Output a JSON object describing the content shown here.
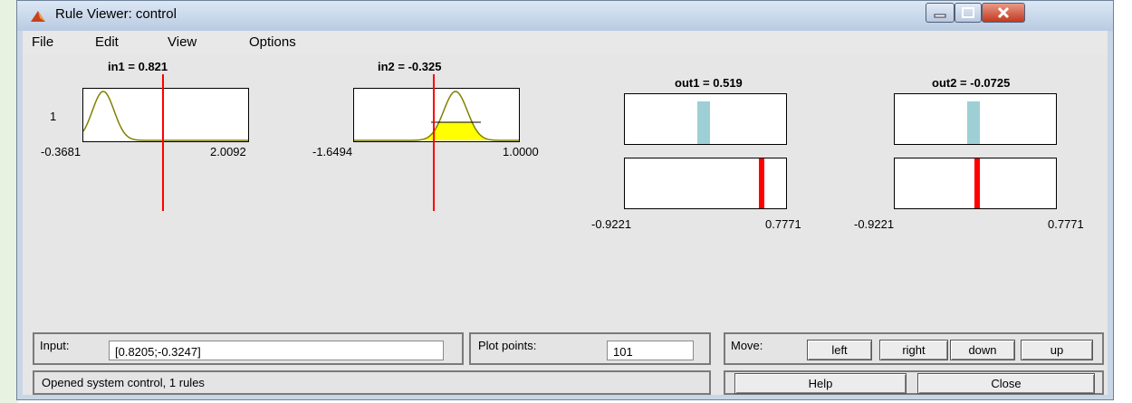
{
  "window": {
    "title": "Rule Viewer: control",
    "icon": "matlab-icon",
    "titlebar_buttons": [
      "minimize-icon",
      "maximize-icon",
      "close-icon"
    ]
  },
  "menu": [
    "File",
    "Edit",
    "View",
    "Options"
  ],
  "inputs": [
    {
      "label": "in1 = 0.821",
      "min": "-0.3681",
      "max": "2.0092",
      "value": 0.821,
      "rule_number": "1"
    },
    {
      "label": "in2 = -0.325",
      "min": "-1.6494",
      "max": "1.0000",
      "value": -0.325
    }
  ],
  "outputs": [
    {
      "label": "out1 = 0.519",
      "min": "-0.9221",
      "max": "0.7771",
      "value": 0.519
    },
    {
      "label": "out2 = -0.0725",
      "min": "-0.9221",
      "max": "0.7771",
      "value": -0.0725
    }
  ],
  "colors": {
    "marker": "#ff0000",
    "mf_line": "#808000",
    "fill": "#ffff00",
    "output_bar": "#9ecfd4"
  },
  "input_panel": {
    "label": "Input:",
    "value": "[0.8205;-0.3247]"
  },
  "plot_points": {
    "label": "Plot points:",
    "value": "101"
  },
  "move": {
    "label": "Move:",
    "buttons": [
      "left",
      "right",
      "down",
      "up"
    ]
  },
  "status": "Opened system control, 1 rules",
  "buttons": {
    "help": "Help",
    "close": "Close"
  }
}
